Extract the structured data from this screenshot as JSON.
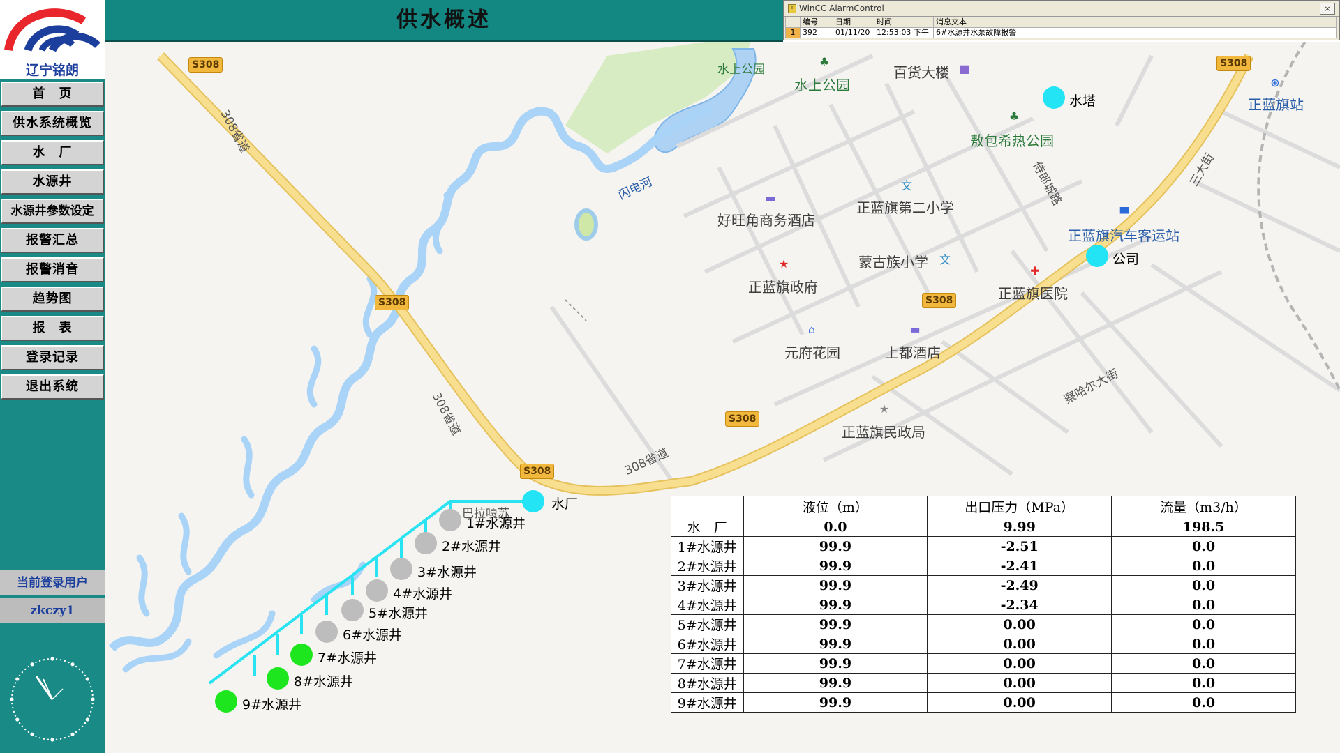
{
  "brand": {
    "name": "辽宁铭朗",
    "colors": {
      "primary": "#1c3f9e",
      "accent": "#e8262b",
      "teal": "#138782"
    }
  },
  "sidebar": {
    "nav": [
      "首　页",
      "供水系统概览",
      "水　厂",
      "水源井",
      "水源井参数设定",
      "报警汇总",
      "报警消音",
      "趋势图",
      "报　表",
      "登录记录",
      "退出系统"
    ],
    "user_title": "当前登录用户",
    "user_name": "zkczy1"
  },
  "header": {
    "title": "供水概述"
  },
  "alarm_control": {
    "window_title": "WinCC AlarmControl",
    "columns": [
      "编号",
      "日期",
      "时间",
      "消息文本"
    ],
    "rows": [
      {
        "index": "1",
        "number": "392",
        "date": "01/11/20",
        "time": "12:53:03 下午",
        "text": "6#水源井水泵故障报警"
      }
    ]
  },
  "map": {
    "road_shields": [
      "S308",
      "S308",
      "S308",
      "S308",
      "S308",
      "S308"
    ],
    "road_labels": [
      "308省道",
      "308省道",
      "308省道"
    ],
    "place_labels": {
      "water_park_area": "水上公园",
      "water_park": "水上公园",
      "dept_store": "百货大楼",
      "aobao_park": "敖包希热公园",
      "haowang_hotel": "好旺角商务酒店",
      "school2": "正蓝旗第二小学",
      "gov": "正蓝旗政府",
      "mongol_school": "蒙古族小学",
      "hospital": "正蓝旗医院",
      "bus_station": "正蓝旗汽车客运站",
      "station": "正蓝旗站",
      "yuanfu": "元府花园",
      "shangdu_hotel": "上都酒店",
      "civil_bureau": "正蓝旗民政局",
      "river": "闪电河",
      "balagasu": "巴拉嘎苏",
      "street_sanda": "三大街",
      "street_chahar": "察哈尔大街",
      "street_shipu": "侍郎城路"
    },
    "nodes": {
      "water_tower": "水塔",
      "company": "公司",
      "plant": "水厂",
      "wells": [
        "1#水源井",
        "2#水源井",
        "3#水源井",
        "4#水源井",
        "5#水源井",
        "6#水源井",
        "7#水源井",
        "8#水源井",
        "9#水源井"
      ],
      "well_status": [
        "stopped",
        "stopped",
        "stopped",
        "stopped",
        "stopped",
        "stopped",
        "running",
        "running",
        "running"
      ],
      "status_colors": {
        "online": "#22e4f4",
        "stopped": "#bdbdbd",
        "running": "#1ee61e"
      }
    }
  },
  "table": {
    "headers": [
      "",
      "液位（m）",
      "出口压力（MPa）",
      "流量（m3/h）"
    ],
    "rows": [
      {
        "name": "水　厂",
        "level": "0.0",
        "pressure": "9.99",
        "flow": "198.5"
      },
      {
        "name": "1#水源井",
        "level": "99.9",
        "pressure": "-2.51",
        "flow": "0.0"
      },
      {
        "name": "2#水源井",
        "level": "99.9",
        "pressure": "-2.41",
        "flow": "0.0"
      },
      {
        "name": "3#水源井",
        "level": "99.9",
        "pressure": "-2.49",
        "flow": "0.0"
      },
      {
        "name": "4#水源井",
        "level": "99.9",
        "pressure": "-2.34",
        "flow": "0.0"
      },
      {
        "name": "5#水源井",
        "level": "99.9",
        "pressure": "0.00",
        "flow": "0.0"
      },
      {
        "name": "6#水源井",
        "level": "99.9",
        "pressure": "0.00",
        "flow": "0.0"
      },
      {
        "name": "7#水源井",
        "level": "99.9",
        "pressure": "0.00",
        "flow": "0.0"
      },
      {
        "name": "8#水源井",
        "level": "99.9",
        "pressure": "0.00",
        "flow": "0.0"
      },
      {
        "name": "9#水源井",
        "level": "99.9",
        "pressure": "0.00",
        "flow": "0.0"
      }
    ]
  }
}
